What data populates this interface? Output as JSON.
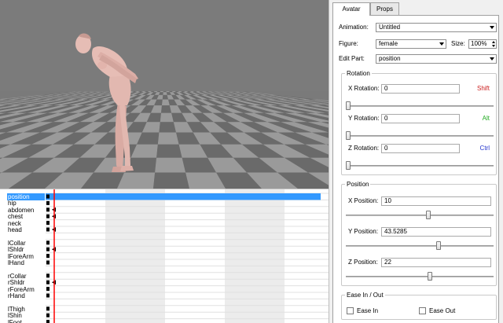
{
  "viewport": {
    "floor_light": "#9a9a9a",
    "floor_dark": "#6a6a6a",
    "sky": "#7b7b7b",
    "figure_skin": "#e2b8b0",
    "figure_shadow": "#c39088"
  },
  "timeline": {
    "tracks": [
      {
        "label": "position",
        "selected": true,
        "row": 0
      },
      {
        "label": "hip",
        "selected": false,
        "row": 1
      },
      {
        "label": "abdomen",
        "selected": false,
        "row": 2
      },
      {
        "label": "chest",
        "selected": false,
        "row": 3
      },
      {
        "label": "neck",
        "selected": false,
        "row": 4
      },
      {
        "label": "head",
        "selected": false,
        "row": 5
      },
      {
        "label": "lCollar",
        "selected": false,
        "row": 7
      },
      {
        "label": "lShldr",
        "selected": false,
        "row": 8
      },
      {
        "label": "lForeArm",
        "selected": false,
        "row": 9
      },
      {
        "label": "lHand",
        "selected": false,
        "row": 10
      },
      {
        "label": "rCollar",
        "selected": false,
        "row": 12
      },
      {
        "label": "rShldr",
        "selected": false,
        "row": 13
      },
      {
        "label": "rForeArm",
        "selected": false,
        "row": 14
      },
      {
        "label": "rHand",
        "selected": false,
        "row": 15
      },
      {
        "label": "lThigh",
        "selected": false,
        "row": 17
      },
      {
        "label": "lShin",
        "selected": false,
        "row": 18
      },
      {
        "label": "lFoot",
        "selected": false,
        "row": 19
      }
    ],
    "playhead_color": "#ff0000",
    "selection_color": "#3399ff"
  },
  "panel": {
    "tabs": [
      {
        "label": "Avatar",
        "active": true
      },
      {
        "label": "Props",
        "active": false
      }
    ],
    "animation": {
      "label": "Animation:",
      "value": "Untitled"
    },
    "figure": {
      "label": "Figure:",
      "value": "female"
    },
    "size": {
      "label": "Size:",
      "value": "100%"
    },
    "edit_part": {
      "label": "Edit Part:",
      "value": "position"
    },
    "rotation": {
      "title": "Rotation",
      "x": {
        "label": "X Rotation:",
        "value": "0",
        "hint": "Shift",
        "hint_color": "#cc2222",
        "slider": 0.0
      },
      "y": {
        "label": "Y Rotation:",
        "value": "0",
        "hint": "Alt",
        "hint_color": "#22aa22",
        "slider": 0.0
      },
      "z": {
        "label": "Z Rotation:",
        "value": "0",
        "hint": "Ctrl",
        "hint_color": "#2233cc",
        "slider": 0.0
      }
    },
    "position": {
      "title": "Position",
      "x": {
        "label": "X Position:",
        "value": "10",
        "slider": 0.56
      },
      "y": {
        "label": "Y Position:",
        "value": "43.5285",
        "slider": 0.63
      },
      "z": {
        "label": "Z Position:",
        "value": "22",
        "slider": 0.57
      }
    },
    "ease": {
      "title": "Ease In / Out",
      "ease_in": {
        "label": "Ease In",
        "checked": false
      },
      "ease_out": {
        "label": "Ease Out",
        "checked": false
      }
    }
  }
}
